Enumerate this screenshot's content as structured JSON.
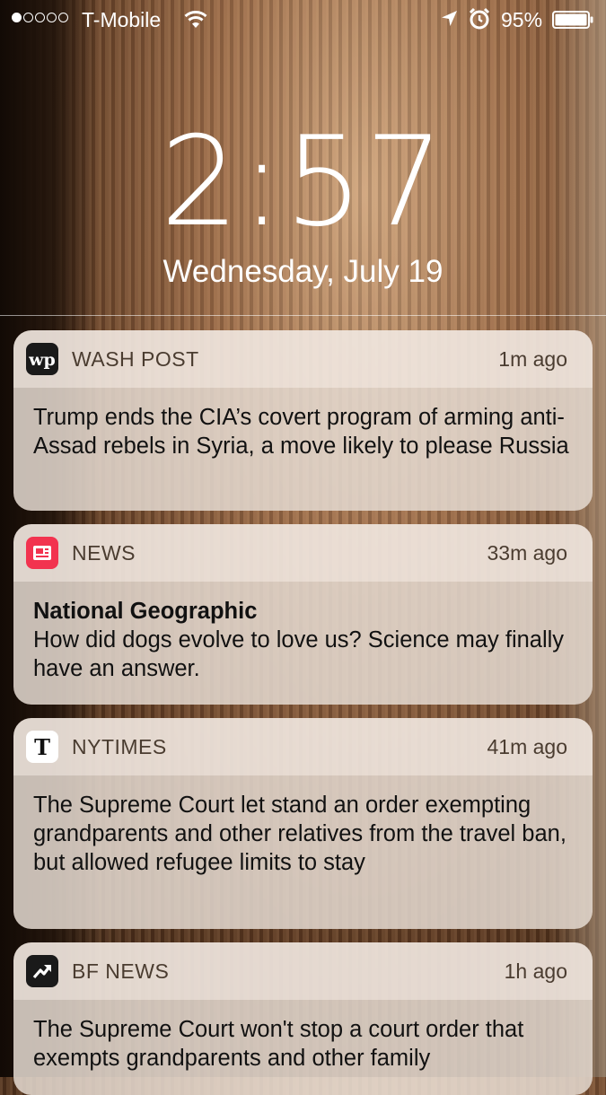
{
  "status_bar": {
    "carrier": "T-Mobile",
    "battery": "95%",
    "signal_bars": 1,
    "icons": [
      "wifi-icon",
      "location-icon",
      "alarm-icon",
      "battery-icon"
    ]
  },
  "lock_screen": {
    "time": "2:57",
    "date": "Wednesday, July 19"
  },
  "notifications": [
    {
      "app": "WASH POST",
      "icon": "wash-post-app-icon",
      "time": "1m ago",
      "title": "",
      "body": "Trump ends the CIA’s covert program of arming anti-Assad rebels in Syria, a move likely to please Russia"
    },
    {
      "app": "NEWS",
      "icon": "apple-news-app-icon",
      "time": "33m ago",
      "title": "National Geographic",
      "body": "How did dogs evolve to love us? Science may finally have an answer."
    },
    {
      "app": "NYTIMES",
      "icon": "nytimes-app-icon",
      "time": "41m ago",
      "title": "",
      "body": "The Supreme Court let stand an order exempting grandparents and other relatives from the travel ban, but allowed refugee limits to stay"
    },
    {
      "app": "BF NEWS",
      "icon": "buzzfeed-news-app-icon",
      "time": "1h ago",
      "title": "",
      "body": "The Supreme Court won't stop a court order that exempts grandparents and other family"
    }
  ],
  "colors": {
    "notification_header": "#f0e6de",
    "notification_body": "#e4dad0",
    "apple_news_red": "#f2334f"
  }
}
